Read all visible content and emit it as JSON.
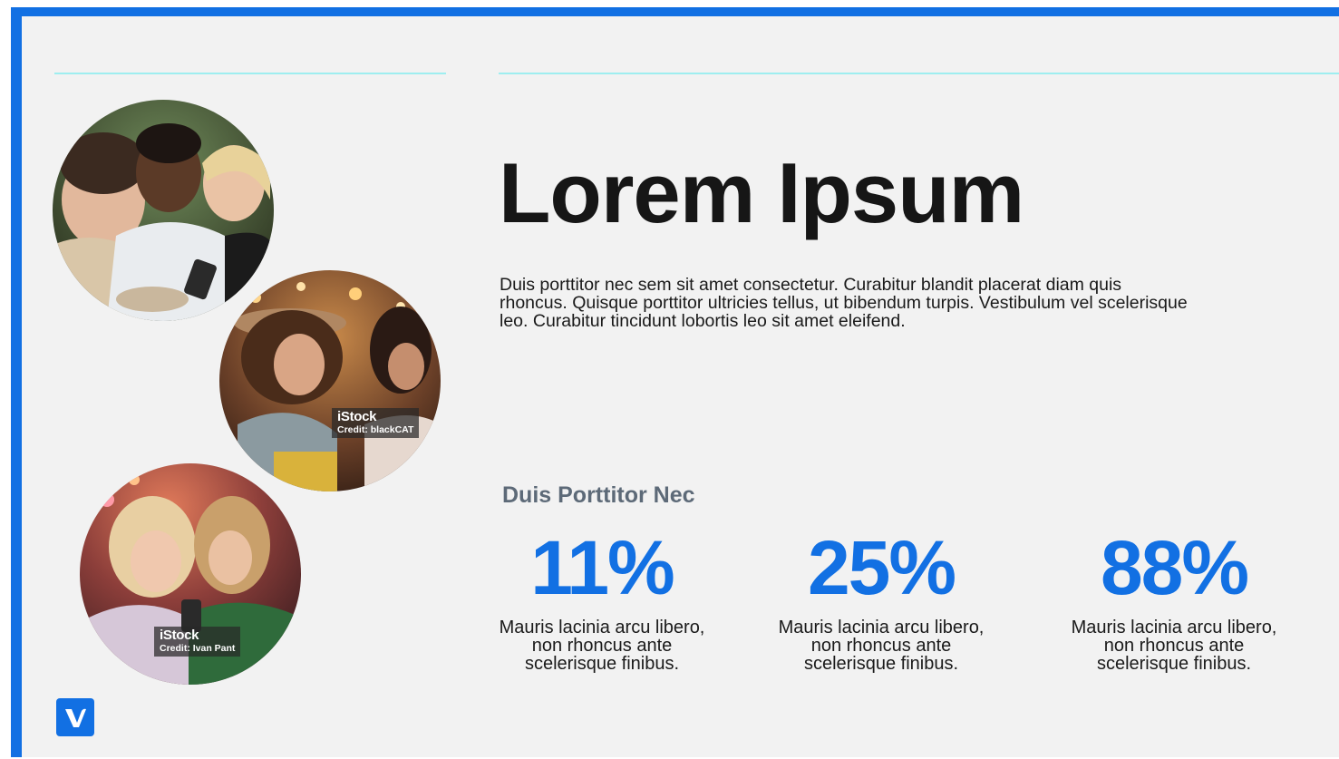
{
  "title": "Lorem Ipsum",
  "body": "Duis porttitor nec sem sit amet consectetur. Curabitur blandit placerat diam quis rhoncus. Quisque porttitor ultricies tellus, ut bibendum turpis. Vestibulum vel scelerisque leo. Curabitur tincidunt lobortis leo sit amet eleifend.",
  "subheading": "Duis Porttitor Nec",
  "stats": [
    {
      "value": "11%",
      "text": "Mauris lacinia arcu libero, non rhoncus ante scelerisque finibus."
    },
    {
      "value": "25%",
      "text": "Mauris lacinia arcu libero, non rhoncus ante scelerisque finibus."
    },
    {
      "value": "88%",
      "text": "Mauris lacinia arcu libero, non rhoncus ante scelerisque finibus."
    }
  ],
  "photos": [
    {
      "subject": "three-women-looking-at-phone"
    },
    {
      "subject": "two-women-laughing-at-carnival",
      "watermark_brand": "iStock",
      "watermark_credit": "Credit: blackCAT"
    },
    {
      "subject": "two-young-women-with-phone",
      "watermark_brand": "iStock",
      "watermark_credit": "Credit: Ivan Pant"
    }
  ],
  "logo_icon": "vev-logo-icon",
  "colors": {
    "accent": "#1270e3",
    "rule": "#9eeef0",
    "subheading": "#5d6a78",
    "background": "#f2f2f2"
  }
}
